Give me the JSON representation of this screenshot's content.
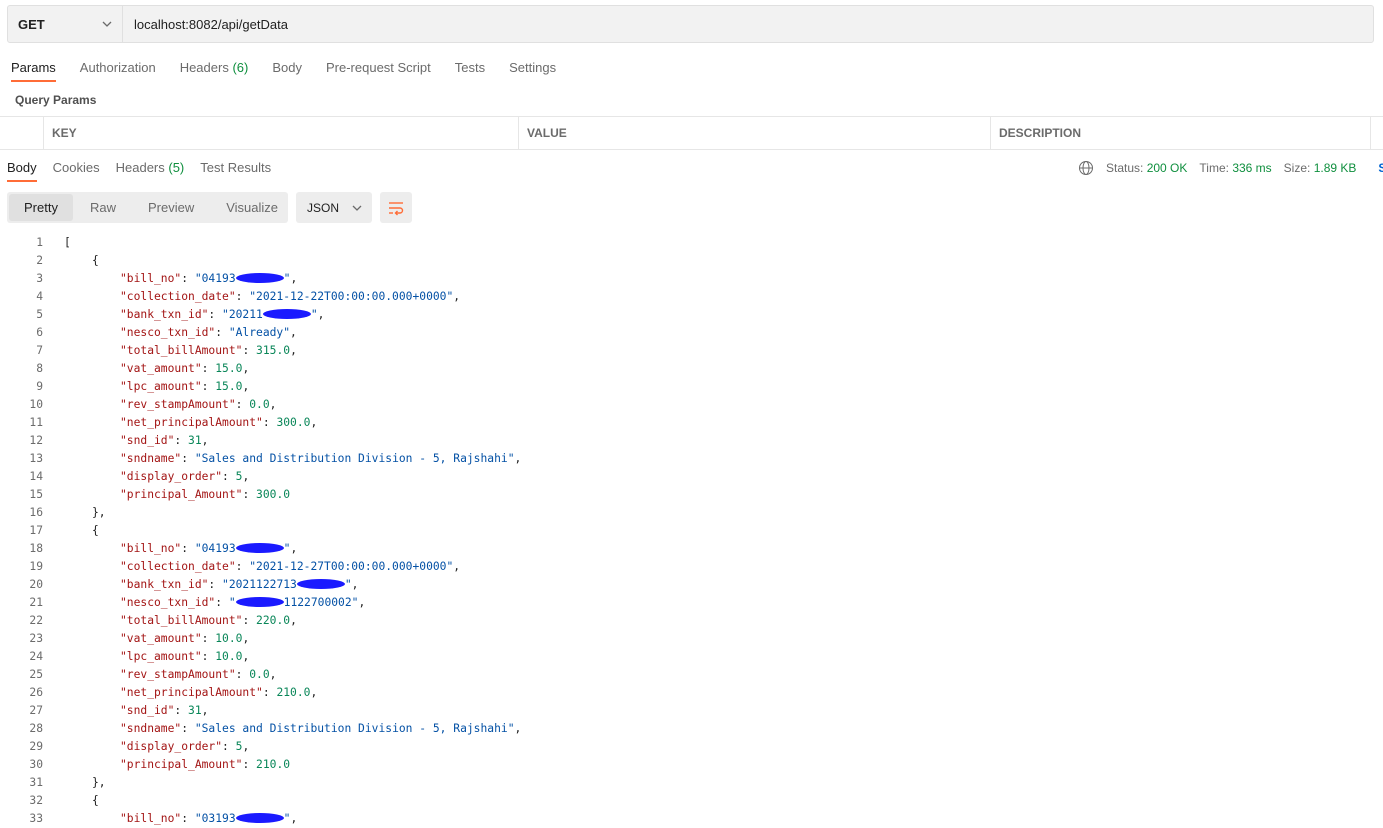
{
  "request": {
    "method": "GET",
    "url": "localhost:8082/api/getData",
    "tabs": [
      {
        "label": "Params",
        "count": ""
      },
      {
        "label": "Authorization",
        "count": ""
      },
      {
        "label": "Headers",
        "count": "(6)"
      },
      {
        "label": "Body",
        "count": ""
      },
      {
        "label": "Pre-request Script",
        "count": ""
      },
      {
        "label": "Tests",
        "count": ""
      },
      {
        "label": "Settings",
        "count": ""
      }
    ],
    "query_params_title": "Query Params",
    "columns": [
      "KEY",
      "VALUE",
      "DESCRIPTION"
    ]
  },
  "response": {
    "tabs": [
      {
        "label": "Body",
        "count": ""
      },
      {
        "label": "Cookies",
        "count": ""
      },
      {
        "label": "Headers",
        "count": "(5)"
      },
      {
        "label": "Test Results",
        "count": ""
      }
    ],
    "status_label": "Status:",
    "status_value": "200 OK",
    "time_label": "Time:",
    "time_value": "336 ms",
    "size_label": "Size:",
    "size_value": "1.89 KB",
    "save_label": "Sa",
    "views": [
      "Pretty",
      "Raw",
      "Preview",
      "Visualize"
    ],
    "format": "JSON",
    "icons": {
      "globe": "globe-icon",
      "wrap": "wrap-lines-icon",
      "chevron": "chevron-down-icon"
    }
  },
  "code_lines": [
    {
      "n": "1",
      "i": 0,
      "parts": [
        [
          "p",
          "["
        ]
      ]
    },
    {
      "n": "2",
      "i": 1,
      "parts": [
        [
          "p",
          "{"
        ]
      ]
    },
    {
      "n": "3",
      "i": 2,
      "parts": [
        [
          "k",
          "\"bill_no\""
        ],
        [
          "p",
          ": "
        ],
        [
          "s",
          "\"04193"
        ],
        [
          "x",
          ""
        ],
        [
          "s",
          "\""
        ],
        [
          "p",
          ","
        ]
      ]
    },
    {
      "n": "4",
      "i": 2,
      "parts": [
        [
          "k",
          "\"collection_date\""
        ],
        [
          "p",
          ": "
        ],
        [
          "s",
          "\"2021-12-22T00:00:00.000+0000\""
        ],
        [
          "p",
          ","
        ]
      ]
    },
    {
      "n": "5",
      "i": 2,
      "parts": [
        [
          "k",
          "\"bank_txn_id\""
        ],
        [
          "p",
          ": "
        ],
        [
          "s",
          "\"20211"
        ],
        [
          "x",
          ""
        ],
        [
          "s",
          "\""
        ],
        [
          "p",
          ","
        ]
      ]
    },
    {
      "n": "6",
      "i": 2,
      "parts": [
        [
          "k",
          "\"nesco_txn_id\""
        ],
        [
          "p",
          ": "
        ],
        [
          "s",
          "\"Already\""
        ],
        [
          "p",
          ","
        ]
      ]
    },
    {
      "n": "7",
      "i": 2,
      "parts": [
        [
          "k",
          "\"total_billAmount\""
        ],
        [
          "p",
          ": "
        ],
        [
          "n",
          "315.0"
        ],
        [
          "p",
          ","
        ]
      ]
    },
    {
      "n": "8",
      "i": 2,
      "parts": [
        [
          "k",
          "\"vat_amount\""
        ],
        [
          "p",
          ": "
        ],
        [
          "n",
          "15.0"
        ],
        [
          "p",
          ","
        ]
      ]
    },
    {
      "n": "9",
      "i": 2,
      "parts": [
        [
          "k",
          "\"lpc_amount\""
        ],
        [
          "p",
          ": "
        ],
        [
          "n",
          "15.0"
        ],
        [
          "p",
          ","
        ]
      ]
    },
    {
      "n": "10",
      "i": 2,
      "parts": [
        [
          "k",
          "\"rev_stampAmount\""
        ],
        [
          "p",
          ": "
        ],
        [
          "n",
          "0.0"
        ],
        [
          "p",
          ","
        ]
      ]
    },
    {
      "n": "11",
      "i": 2,
      "parts": [
        [
          "k",
          "\"net_principalAmount\""
        ],
        [
          "p",
          ": "
        ],
        [
          "n",
          "300.0"
        ],
        [
          "p",
          ","
        ]
      ]
    },
    {
      "n": "12",
      "i": 2,
      "parts": [
        [
          "k",
          "\"snd_id\""
        ],
        [
          "p",
          ": "
        ],
        [
          "n",
          "31"
        ],
        [
          "p",
          ","
        ]
      ]
    },
    {
      "n": "13",
      "i": 2,
      "parts": [
        [
          "k",
          "\"sndname\""
        ],
        [
          "p",
          ": "
        ],
        [
          "s",
          "\"Sales and Distribution Division - 5, Rajshahi\""
        ],
        [
          "p",
          ","
        ]
      ]
    },
    {
      "n": "14",
      "i": 2,
      "parts": [
        [
          "k",
          "\"display_order\""
        ],
        [
          "p",
          ": "
        ],
        [
          "n",
          "5"
        ],
        [
          "p",
          ","
        ]
      ]
    },
    {
      "n": "15",
      "i": 2,
      "parts": [
        [
          "k",
          "\"principal_Amount\""
        ],
        [
          "p",
          ": "
        ],
        [
          "n",
          "300.0"
        ]
      ]
    },
    {
      "n": "16",
      "i": 1,
      "parts": [
        [
          "p",
          "},"
        ]
      ]
    },
    {
      "n": "17",
      "i": 1,
      "parts": [
        [
          "p",
          "{"
        ]
      ]
    },
    {
      "n": "18",
      "i": 2,
      "parts": [
        [
          "k",
          "\"bill_no\""
        ],
        [
          "p",
          ": "
        ],
        [
          "s",
          "\"04193"
        ],
        [
          "x",
          ""
        ],
        [
          "s",
          "\""
        ],
        [
          "p",
          ","
        ]
      ]
    },
    {
      "n": "19",
      "i": 2,
      "parts": [
        [
          "k",
          "\"collection_date\""
        ],
        [
          "p",
          ": "
        ],
        [
          "s",
          "\"2021-12-27T00:00:00.000+0000\""
        ],
        [
          "p",
          ","
        ]
      ]
    },
    {
      "n": "20",
      "i": 2,
      "parts": [
        [
          "k",
          "\"bank_txn_id\""
        ],
        [
          "p",
          ": "
        ],
        [
          "s",
          "\"2021122713"
        ],
        [
          "x",
          ""
        ],
        [
          "s",
          "\""
        ],
        [
          "p",
          ","
        ]
      ]
    },
    {
      "n": "21",
      "i": 2,
      "parts": [
        [
          "k",
          "\"nesco_txn_id\""
        ],
        [
          "p",
          ": "
        ],
        [
          "s",
          "\""
        ],
        [
          "x",
          ""
        ],
        [
          "s",
          "1122700002\""
        ],
        [
          "p",
          ","
        ]
      ]
    },
    {
      "n": "22",
      "i": 2,
      "parts": [
        [
          "k",
          "\"total_billAmount\""
        ],
        [
          "p",
          ": "
        ],
        [
          "n",
          "220.0"
        ],
        [
          "p",
          ","
        ]
      ]
    },
    {
      "n": "23",
      "i": 2,
      "parts": [
        [
          "k",
          "\"vat_amount\""
        ],
        [
          "p",
          ": "
        ],
        [
          "n",
          "10.0"
        ],
        [
          "p",
          ","
        ]
      ]
    },
    {
      "n": "24",
      "i": 2,
      "parts": [
        [
          "k",
          "\"lpc_amount\""
        ],
        [
          "p",
          ": "
        ],
        [
          "n",
          "10.0"
        ],
        [
          "p",
          ","
        ]
      ]
    },
    {
      "n": "25",
      "i": 2,
      "parts": [
        [
          "k",
          "\"rev_stampAmount\""
        ],
        [
          "p",
          ": "
        ],
        [
          "n",
          "0.0"
        ],
        [
          "p",
          ","
        ]
      ]
    },
    {
      "n": "26",
      "i": 2,
      "parts": [
        [
          "k",
          "\"net_principalAmount\""
        ],
        [
          "p",
          ": "
        ],
        [
          "n",
          "210.0"
        ],
        [
          "p",
          ","
        ]
      ]
    },
    {
      "n": "27",
      "i": 2,
      "parts": [
        [
          "k",
          "\"snd_id\""
        ],
        [
          "p",
          ": "
        ],
        [
          "n",
          "31"
        ],
        [
          "p",
          ","
        ]
      ]
    },
    {
      "n": "28",
      "i": 2,
      "parts": [
        [
          "k",
          "\"sndname\""
        ],
        [
          "p",
          ": "
        ],
        [
          "s",
          "\"Sales and Distribution Division - 5, Rajshahi\""
        ],
        [
          "p",
          ","
        ]
      ]
    },
    {
      "n": "29",
      "i": 2,
      "parts": [
        [
          "k",
          "\"display_order\""
        ],
        [
          "p",
          ": "
        ],
        [
          "n",
          "5"
        ],
        [
          "p",
          ","
        ]
      ]
    },
    {
      "n": "30",
      "i": 2,
      "parts": [
        [
          "k",
          "\"principal_Amount\""
        ],
        [
          "p",
          ": "
        ],
        [
          "n",
          "210.0"
        ]
      ]
    },
    {
      "n": "31",
      "i": 1,
      "parts": [
        [
          "p",
          "},"
        ]
      ]
    },
    {
      "n": "32",
      "i": 1,
      "parts": [
        [
          "p",
          "{"
        ]
      ]
    },
    {
      "n": "33",
      "i": 2,
      "parts": [
        [
          "k",
          "\"bill_no\""
        ],
        [
          "p",
          ": "
        ],
        [
          "s",
          "\"03193"
        ],
        [
          "x",
          ""
        ],
        [
          "s",
          "\""
        ],
        [
          "p",
          ","
        ]
      ]
    }
  ]
}
